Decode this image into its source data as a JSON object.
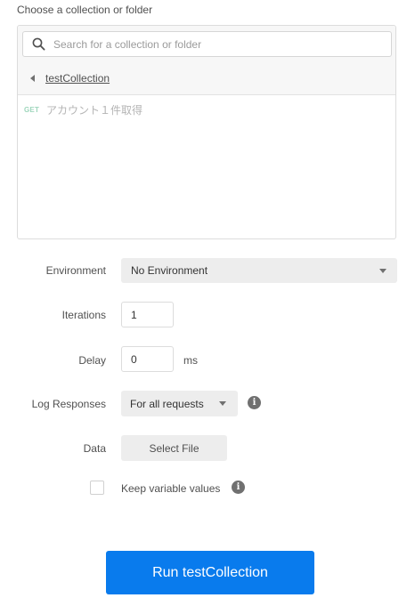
{
  "collection_picker": {
    "title": "Choose a collection or folder",
    "search_placeholder": "Search for a collection or folder",
    "breadcrumb_label": "testCollection",
    "requests": [
      {
        "method": "GET",
        "name": "アカウント１件取得"
      }
    ]
  },
  "environment": {
    "label": "Environment",
    "value": "No Environment"
  },
  "iterations": {
    "label": "Iterations",
    "value": "1"
  },
  "delay": {
    "label": "Delay",
    "value": "0",
    "unit": "ms"
  },
  "log_responses": {
    "label": "Log Responses",
    "value": "For all requests"
  },
  "data": {
    "label": "Data",
    "button_label": "Select File"
  },
  "keep_variables": {
    "label": "Keep variable values",
    "checked": false
  },
  "run_button": {
    "label": "Run testCollection"
  },
  "colors": {
    "accent": "#097bed",
    "method_get": "#9ed6bc",
    "field_bg": "#ededed"
  },
  "icons": [
    "search-icon",
    "back-arrow-icon",
    "caret-down-icon",
    "info-icon"
  ]
}
